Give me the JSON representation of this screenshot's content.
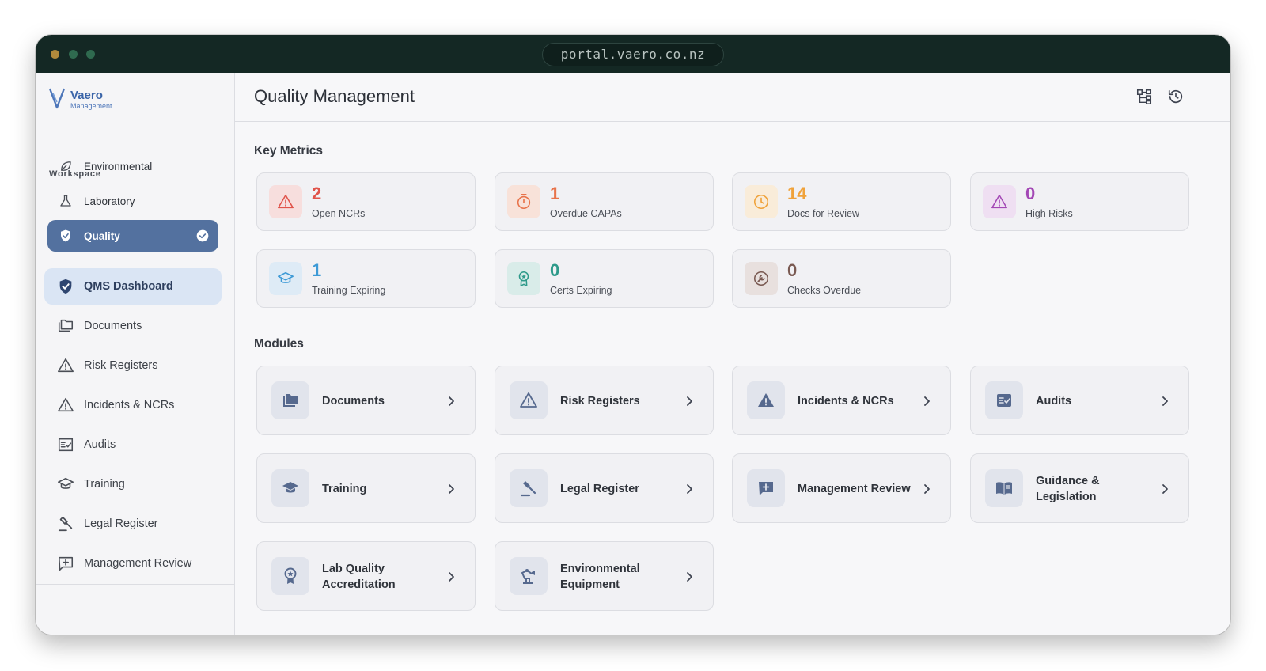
{
  "browser": {
    "url": "portal.vaero.co.nz"
  },
  "brand": {
    "name": "Vaero",
    "subtitle": "Management"
  },
  "workspace": {
    "label": "Workspace",
    "items": [
      {
        "label": "Environmental",
        "icon": "leaf-icon"
      },
      {
        "label": "Laboratory",
        "icon": "flask-icon"
      },
      {
        "label": "Quality",
        "icon": "shield-check-icon",
        "active": true
      }
    ]
  },
  "nav": {
    "items": [
      {
        "label": "QMS Dashboard",
        "icon": "shield-check-icon",
        "active": true
      },
      {
        "label": "Documents",
        "icon": "folders-icon"
      },
      {
        "label": "Risk Registers",
        "icon": "warning-icon"
      },
      {
        "label": "Incidents & NCRs",
        "icon": "warning-icon"
      },
      {
        "label": "Audits",
        "icon": "checklist-icon"
      },
      {
        "label": "Training",
        "icon": "graduation-cap-icon"
      },
      {
        "label": "Legal Register",
        "icon": "gavel-icon"
      },
      {
        "label": "Management Review",
        "icon": "review-icon"
      }
    ]
  },
  "header": {
    "title": "Quality Management"
  },
  "metrics": {
    "title": "Key Metrics",
    "items": [
      {
        "value": "2",
        "label": "Open NCRs",
        "color": "#e0534a",
        "bg": "#f7dedd",
        "icon": "warning-icon"
      },
      {
        "value": "1",
        "label": "Overdue CAPAs",
        "color": "#e8734a",
        "bg": "#f8e2d9",
        "icon": "timer-icon"
      },
      {
        "value": "14",
        "label": "Docs for Review",
        "color": "#f0a23a",
        "bg": "#f9ecd9",
        "icon": "clock-icon"
      },
      {
        "value": "0",
        "label": "High Risks",
        "color": "#a347b5",
        "bg": "#efdff2",
        "icon": "warning-icon"
      },
      {
        "value": "1",
        "label": "Training Expiring",
        "color": "#3d9ad6",
        "bg": "#deebf6",
        "icon": "graduation-cap-icon"
      },
      {
        "value": "0",
        "label": "Certs Expiring",
        "color": "#2e9a8a",
        "bg": "#d9ece9",
        "icon": "award-icon"
      },
      {
        "value": "0",
        "label": "Checks Overdue",
        "color": "#7a5a52",
        "bg": "#e8e0de",
        "icon": "wrench-icon"
      }
    ]
  },
  "modules": {
    "title": "Modules",
    "items": [
      {
        "label": "Documents",
        "icon": "folders-icon"
      },
      {
        "label": "Risk Registers",
        "icon": "warning-icon"
      },
      {
        "label": "Incidents & NCRs",
        "icon": "warning-filled-icon"
      },
      {
        "label": "Audits",
        "icon": "checklist-icon"
      },
      {
        "label": "Training",
        "icon": "graduation-cap-icon"
      },
      {
        "label": "Legal Register",
        "icon": "gavel-icon"
      },
      {
        "label": "Management Review",
        "icon": "review-icon"
      },
      {
        "label": "Guidance & Legislation",
        "icon": "book-icon"
      },
      {
        "label": "Lab Quality Accreditation",
        "icon": "award-icon"
      },
      {
        "label": "Environmental Equipment",
        "icon": "equipment-icon"
      }
    ]
  },
  "colors": {
    "accent": "#53719f",
    "module_icon": "#56698e",
    "titlebar": "#142824"
  }
}
